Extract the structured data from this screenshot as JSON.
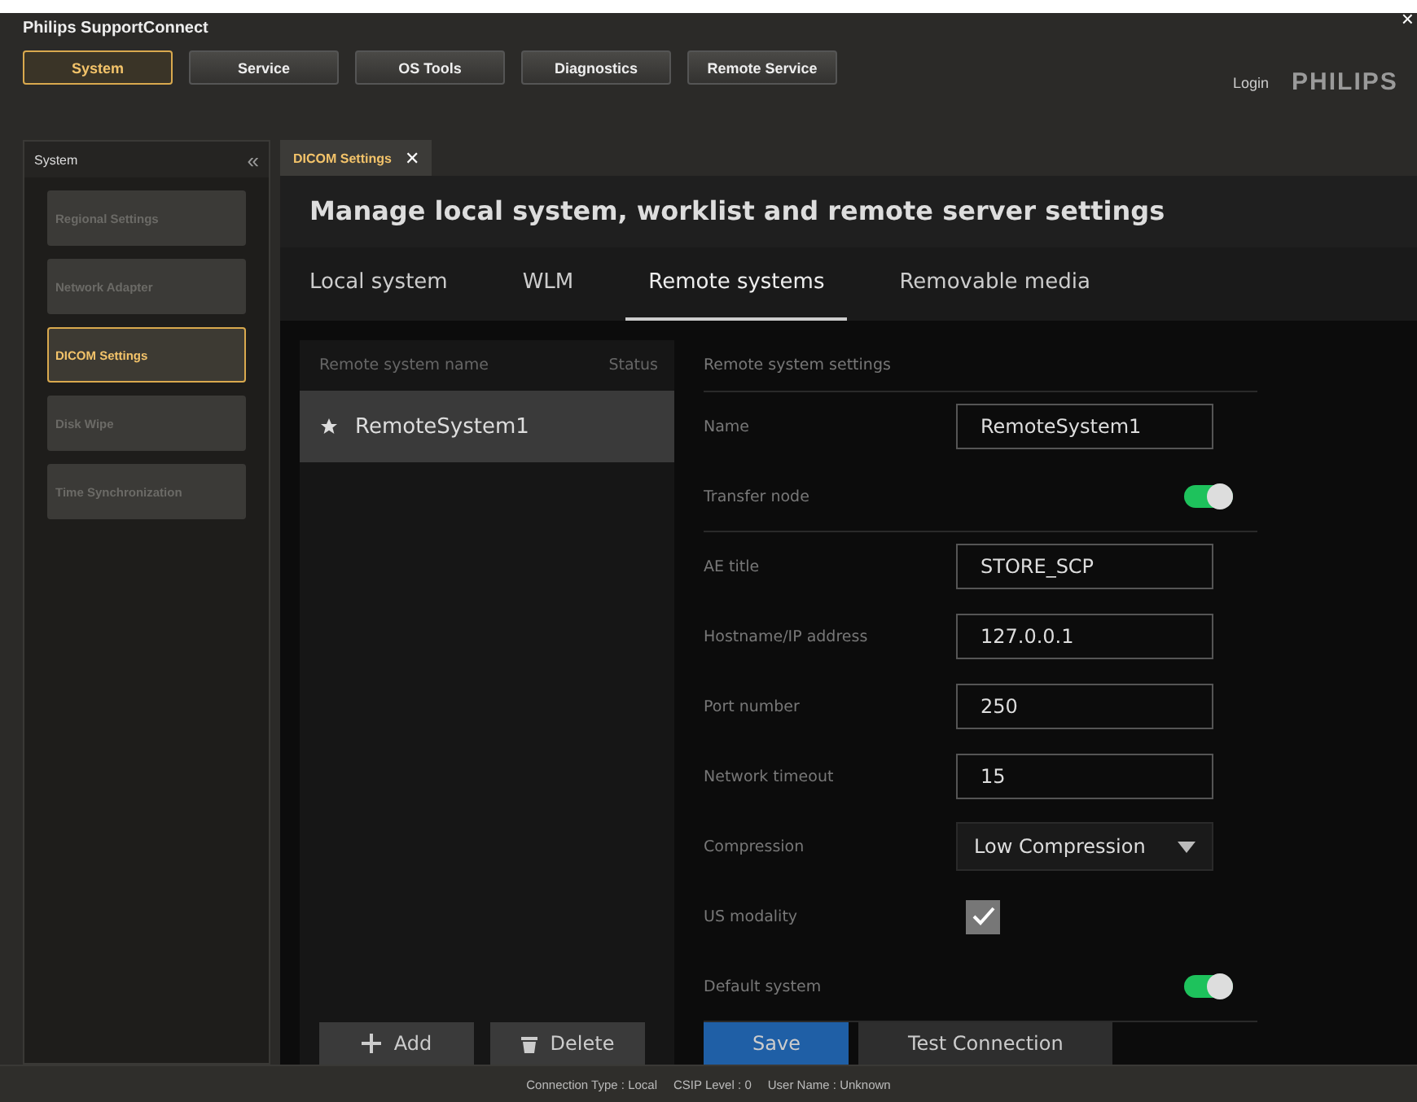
{
  "app_title": "Philips SupportConnect",
  "nav": [
    {
      "label": "System",
      "selected": true
    },
    {
      "label": "Service",
      "selected": false
    },
    {
      "label": "OS Tools",
      "selected": false
    },
    {
      "label": "Diagnostics",
      "selected": false
    },
    {
      "label": "Remote Service",
      "selected": false
    }
  ],
  "login": "Login",
  "brand": "PHILIPS",
  "close": "×",
  "sidebar": {
    "title": "System",
    "collapse": "«",
    "items": [
      {
        "label": "Regional Settings",
        "selected": false
      },
      {
        "label": "Network Adapter",
        "selected": false
      },
      {
        "label": "DICOM Settings",
        "selected": true
      },
      {
        "label": "Disk Wipe",
        "selected": false
      },
      {
        "label": "Time Synchronization",
        "selected": false
      }
    ]
  },
  "doc_tab": {
    "label": "DICOM Settings",
    "close": "✕"
  },
  "heading": "Manage local system, worklist and remote server settings",
  "tabs": [
    {
      "label": "Local system",
      "selected": false
    },
    {
      "label": "WLM",
      "selected": false
    },
    {
      "label": "Remote systems",
      "selected": true
    },
    {
      "label": "Removable media",
      "selected": false
    }
  ],
  "remote_list": {
    "columns": [
      "Remote system name",
      "Status"
    ],
    "rows": [
      {
        "name": "RemoteSystem1",
        "default": true,
        "selected": true
      }
    ],
    "buttons": [
      {
        "label": "Add",
        "kind": "add"
      },
      {
        "label": "Delete",
        "kind": "delete"
      }
    ]
  },
  "settings": {
    "title": "Remote system settings",
    "fields": [
      {
        "kind": "text",
        "label": "Name",
        "value": "RemoteSystem1",
        "divider": false
      },
      {
        "kind": "toggle",
        "label": "Transfer node",
        "on": true,
        "divider": true
      },
      {
        "kind": "text",
        "label": "AE title",
        "value": "STORE_SCP",
        "divider": false
      },
      {
        "kind": "text",
        "label": "Hostname/IP address",
        "value": "127.0.0.1",
        "divider": false
      },
      {
        "kind": "text",
        "label": "Port number",
        "value": "250",
        "divider": false
      },
      {
        "kind": "text",
        "label": "Network timeout",
        "value": "15",
        "divider": false
      },
      {
        "kind": "select",
        "label": "Compression",
        "value": "Low Compression",
        "divider": false
      },
      {
        "kind": "checkbox",
        "label": "US modality",
        "checked": true,
        "divider": false
      },
      {
        "kind": "toggle",
        "label": "Default system",
        "on": true,
        "divider": true
      }
    ],
    "buttons": [
      {
        "label": "Save",
        "kind": "primary"
      },
      {
        "label": "Test Connection",
        "kind": "secondary"
      }
    ]
  },
  "status_bar": [
    {
      "label": "Connection Type",
      "separator": ":",
      "value": "Local"
    },
    {
      "label": "CSIP Level",
      "separator": ":",
      "value": "0"
    },
    {
      "label": "User Name",
      "separator": ":",
      "value": "Unknown"
    }
  ]
}
